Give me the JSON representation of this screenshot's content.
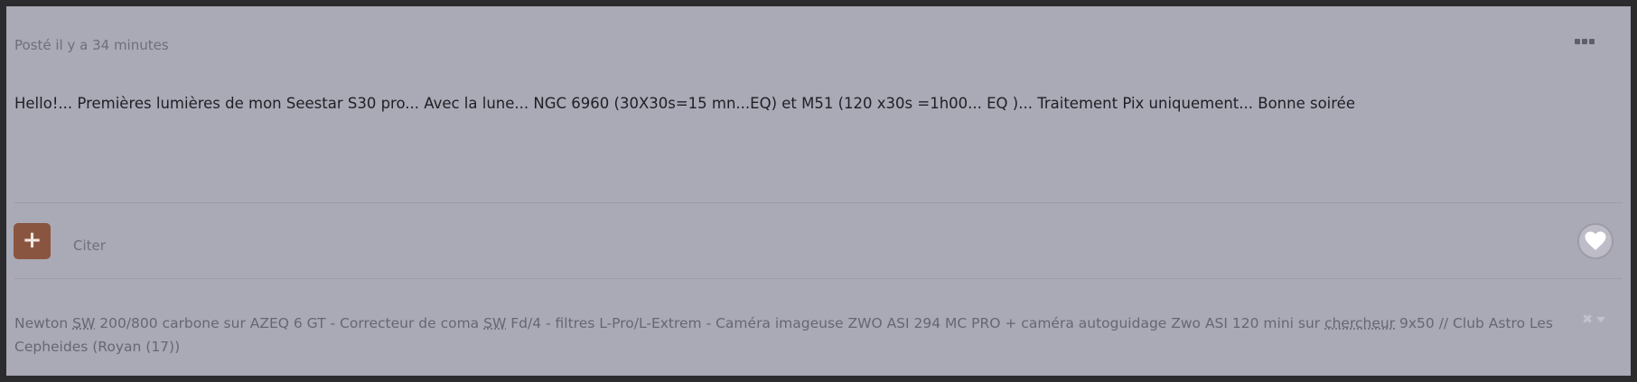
{
  "post": {
    "meta": "Posté il y a 34 minutes",
    "body": "Hello!... Premières lumières de mon Seestar S30 pro... Avec la lune... NGC 6960 (30X30s=15 mn...EQ) et M51 (120 x30s =1h00... EQ )... Traitement Pix uniquement... Bonne soirée",
    "more_icon": "more-dots-icon"
  },
  "actions": {
    "plus_label": "+",
    "quote_label": "Citer",
    "reaction_icon": "heart-icon"
  },
  "signature": {
    "part1": "Newton ",
    "abbr1": "SW",
    "part2": " 200/800 carbone sur AZEQ 6 GT  -   Correcteur de coma ",
    "abbr2": "SW",
    "part3": " Fd/4 - filtres L-Pro/L-Extrem - Caméra imageuse ZWO ASI 294 MC PRO + caméra autoguidage Zwo ASI 120 mini sur ",
    "abbr3": "chercheur",
    "part4": " 9x50 // Club Astro Les Cepheides (Royan (17))",
    "close_symbol": "✖",
    "close_icon": "close-icon"
  },
  "colors": {
    "background": "#2c2c2e",
    "post_background": "#aaa9b6",
    "plus_button": "#8a5540"
  }
}
